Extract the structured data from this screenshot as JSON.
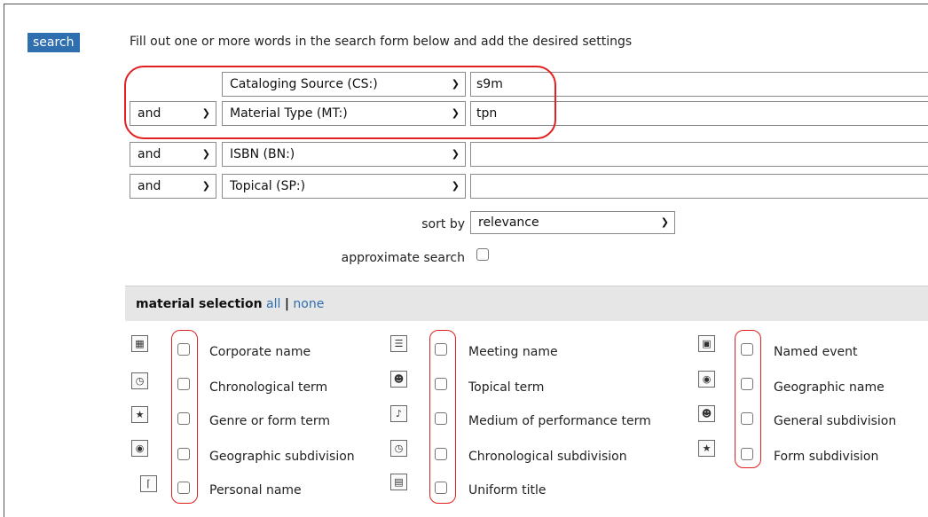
{
  "search_tab": "search",
  "intro_text": "Fill out one or more words in the search form below and add the desired settings",
  "rows": [
    {
      "operator": "",
      "field": "Cataloging Source (CS:)",
      "value": "s9m"
    },
    {
      "operator": "and",
      "field": "Material Type (MT:)",
      "value": "tpn"
    },
    {
      "operator": "and",
      "field": "ISBN (BN:)",
      "value": ""
    },
    {
      "operator": "and",
      "field": "Topical (SP:)",
      "value": ""
    }
  ],
  "sort": {
    "label": "sort by",
    "value": "relevance"
  },
  "approx": {
    "label": "approximate search"
  },
  "material": {
    "heading": "material selection",
    "all": "all",
    "separator": "|",
    "none": "none",
    "col1": [
      "Corporate name",
      "Chronological term",
      "Genre or form term",
      "Geographic subdivision",
      "Personal name"
    ],
    "col2": [
      "Meeting name",
      "Topical term",
      "Medium of performance term",
      "Chronological subdivision",
      "Uniform title"
    ],
    "col3": [
      "Named event",
      "Geographic name",
      "General subdivision",
      "Form subdivision"
    ]
  },
  "colors": {
    "accent": "#2f6fb0",
    "highlight": "#e02020",
    "bar": "#e6e6e6"
  }
}
